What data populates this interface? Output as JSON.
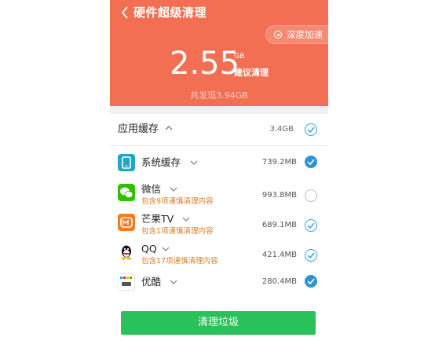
{
  "header": {
    "title": "硬件超级清理",
    "deep_accelerate": "深度加速",
    "size_value": "2.55",
    "size_unit": "GB",
    "suggest_label": "建议清理",
    "found_text": "共发现3.94GB",
    "color": "#f36f53"
  },
  "group": {
    "name": "应用缓存",
    "size": "3.4GB",
    "checked": "partial"
  },
  "items": [
    {
      "name": "系统缓存",
      "sub": "",
      "size": "739.2MB",
      "checked": true,
      "icon": "system-cache-icon"
    },
    {
      "name": "微信",
      "sub": "包含9项谨慎清理内容",
      "size": "993.8MB",
      "checked": false,
      "icon": "wechat-icon"
    },
    {
      "name": "芒果TV",
      "sub": "包含1项谨慎清理内容",
      "size": "689.1MB",
      "checked": "outline",
      "icon": "mangotv-icon"
    },
    {
      "name": "QQ",
      "sub": "包含17项谨慎清理内容",
      "size": "421.4MB",
      "checked": "outline",
      "icon": "qq-icon"
    },
    {
      "name": "优酷",
      "sub": "",
      "size": "280.4MB",
      "checked": true,
      "icon": "youku-icon"
    }
  ],
  "clean_button": "清理垃圾",
  "colors": {
    "accent_blue": "#2c93d6",
    "button_green": "#2ac05a",
    "warning_orange": "#e07a1f"
  }
}
